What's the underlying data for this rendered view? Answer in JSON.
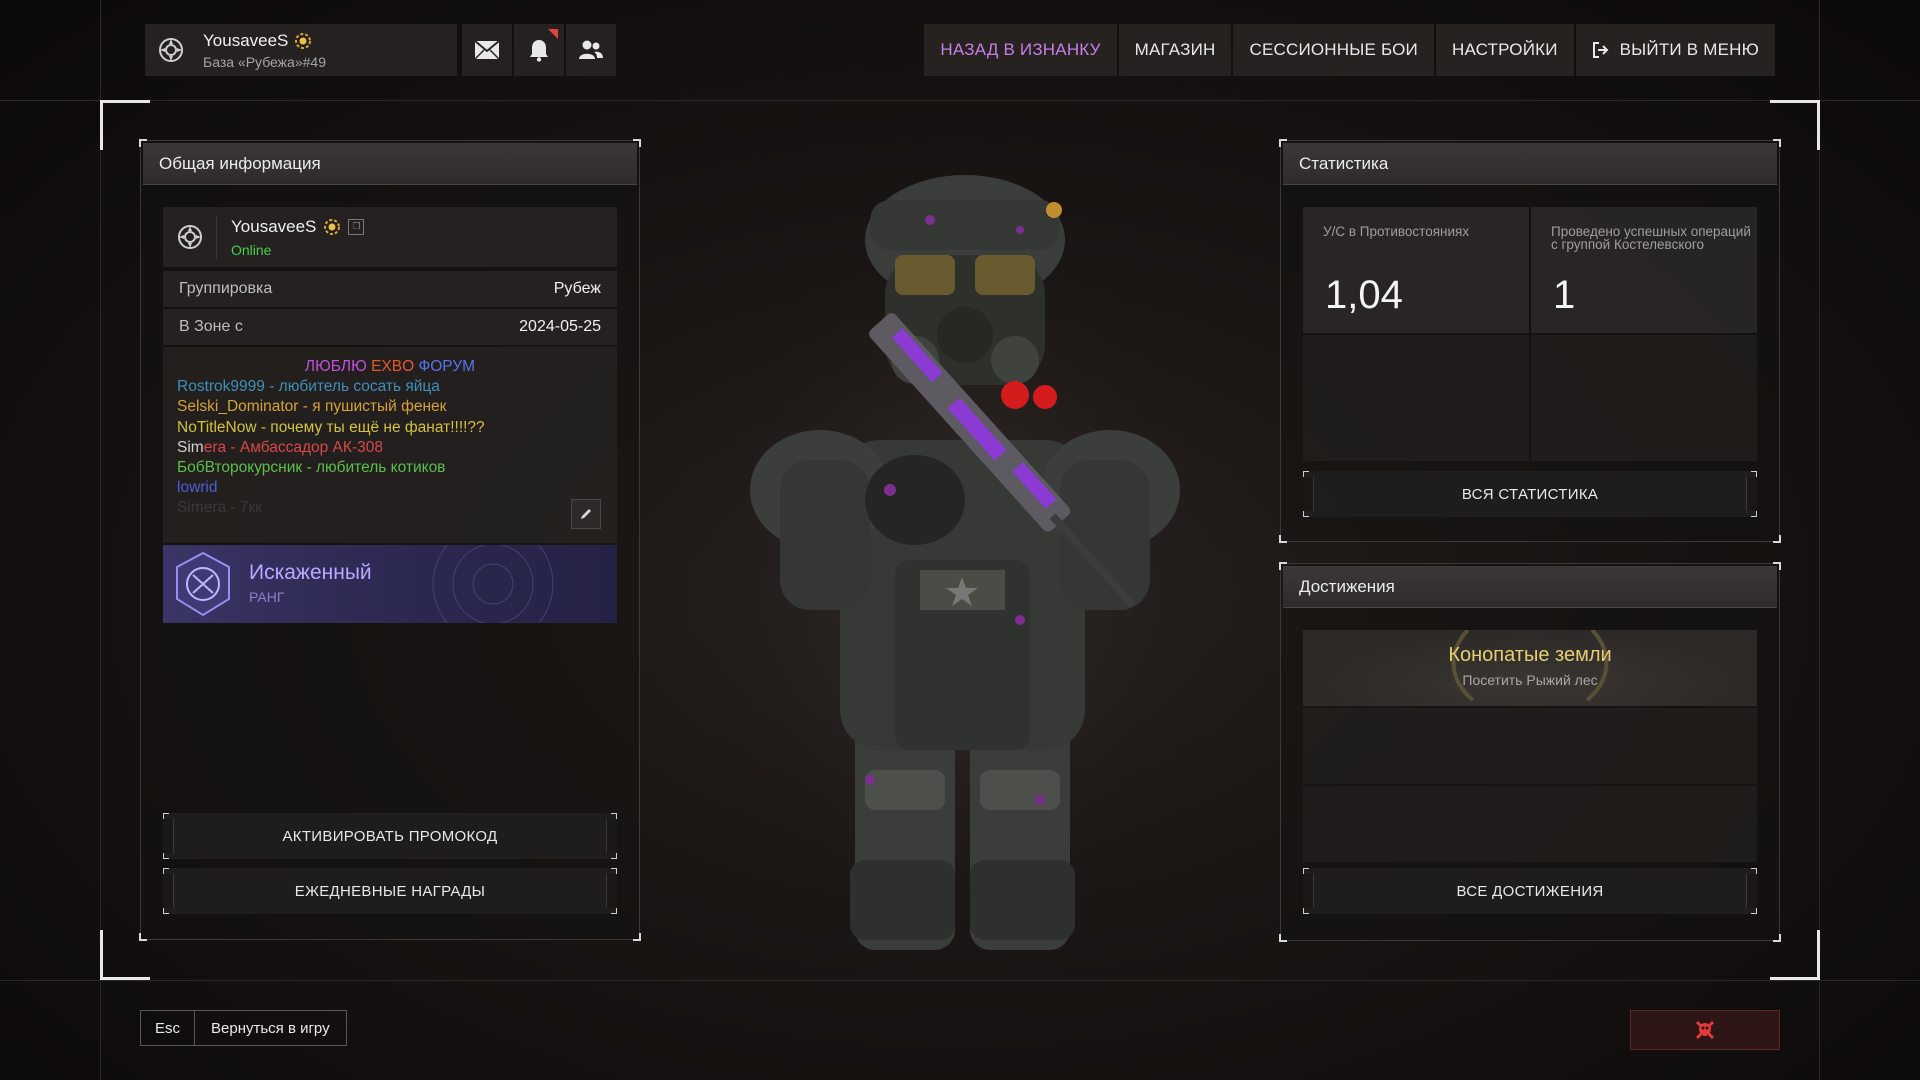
{
  "topbar": {
    "nickname": "YousaveeS",
    "base": "База «Рубежа»#49",
    "icons": [
      "mail-icon",
      "bell-icon",
      "friends-icon"
    ],
    "nav": [
      {
        "label": "НАЗАД В ИЗНАНКУ",
        "accent": true
      },
      {
        "label": "МАГАЗИН"
      },
      {
        "label": "СЕССИОННЫЕ БОИ"
      },
      {
        "label": "НАСТРОЙКИ"
      },
      {
        "label": "ВЫЙТИ В МЕНЮ",
        "icon": "exit-icon"
      }
    ]
  },
  "general": {
    "title": "Общая информация",
    "nickname": "YousaveeS",
    "status": "Online",
    "rows": [
      {
        "key": "Группировка",
        "value": "Рубеж"
      },
      {
        "key": "В Зоне с",
        "value": "2024-05-25"
      }
    ],
    "bio_lines": [
      [
        {
          "t": "ЛЮБЛЮ ",
          "c": "#c34fe0"
        },
        {
          "t": "EXBO ",
          "c": "#e35a2f"
        },
        {
          "t": "ФОРУМ",
          "c": "#5576ea"
        }
      ],
      [
        {
          "t": "Rostrok9999 - любитель сосать яйца",
          "c": "#3e90b8"
        }
      ],
      [
        {
          "t": "Selski_Dominator - я пушистый фенек",
          "c": "#d6a23a"
        }
      ],
      [
        {
          "t": "NoTitleNow - почему ты ещё не фанат!!!!??",
          "c": "#d2c23e"
        }
      ],
      [
        {
          "t": "Sim",
          "c": "#d3d3d3"
        },
        {
          "t": "era - Амбассадор АК-308",
          "c": "#d84848"
        }
      ],
      [
        {
          "t": "БобВторокурсник - любитель котиков",
          "c": "#5cbf4a"
        }
      ],
      [
        {
          "t": "lowrid",
          "c": "#4c5cd8"
        }
      ],
      [
        {
          "t": "Simera - 7кк",
          "c": "#3b3938"
        }
      ]
    ],
    "rank_name": "Искаженный",
    "rank_sub": "РАНГ",
    "promo_button": "АКТИВИРОВАТЬ ПРОМОКОД",
    "daily_button": "ЕЖЕДНЕВНЫЕ НАГРАДЫ"
  },
  "stats": {
    "title": "Статистика",
    "cells": [
      {
        "label": "У/С в Противостояниях",
        "value": "1,04"
      },
      {
        "label": "Проведено успешных операций с группой Костелевского",
        "value": "1"
      }
    ],
    "all_button": "ВСЯ СТАТИСТИКА"
  },
  "achievements": {
    "title": "Достижения",
    "items": [
      {
        "title": "Конопатые земли",
        "desc": "Посетить Рыжий лес"
      }
    ],
    "all_button": "ВСЕ ДОСТИЖЕНИЯ"
  },
  "bottom": {
    "esc_key": "Esc",
    "esc_label": "Вернуться в игру",
    "danger_icon": "skull-icon"
  },
  "colors": {
    "accent": "#c67fe6",
    "online": "#46d14a",
    "achievement_gold": "#e6cf73",
    "rank": "#b9a8ff"
  }
}
